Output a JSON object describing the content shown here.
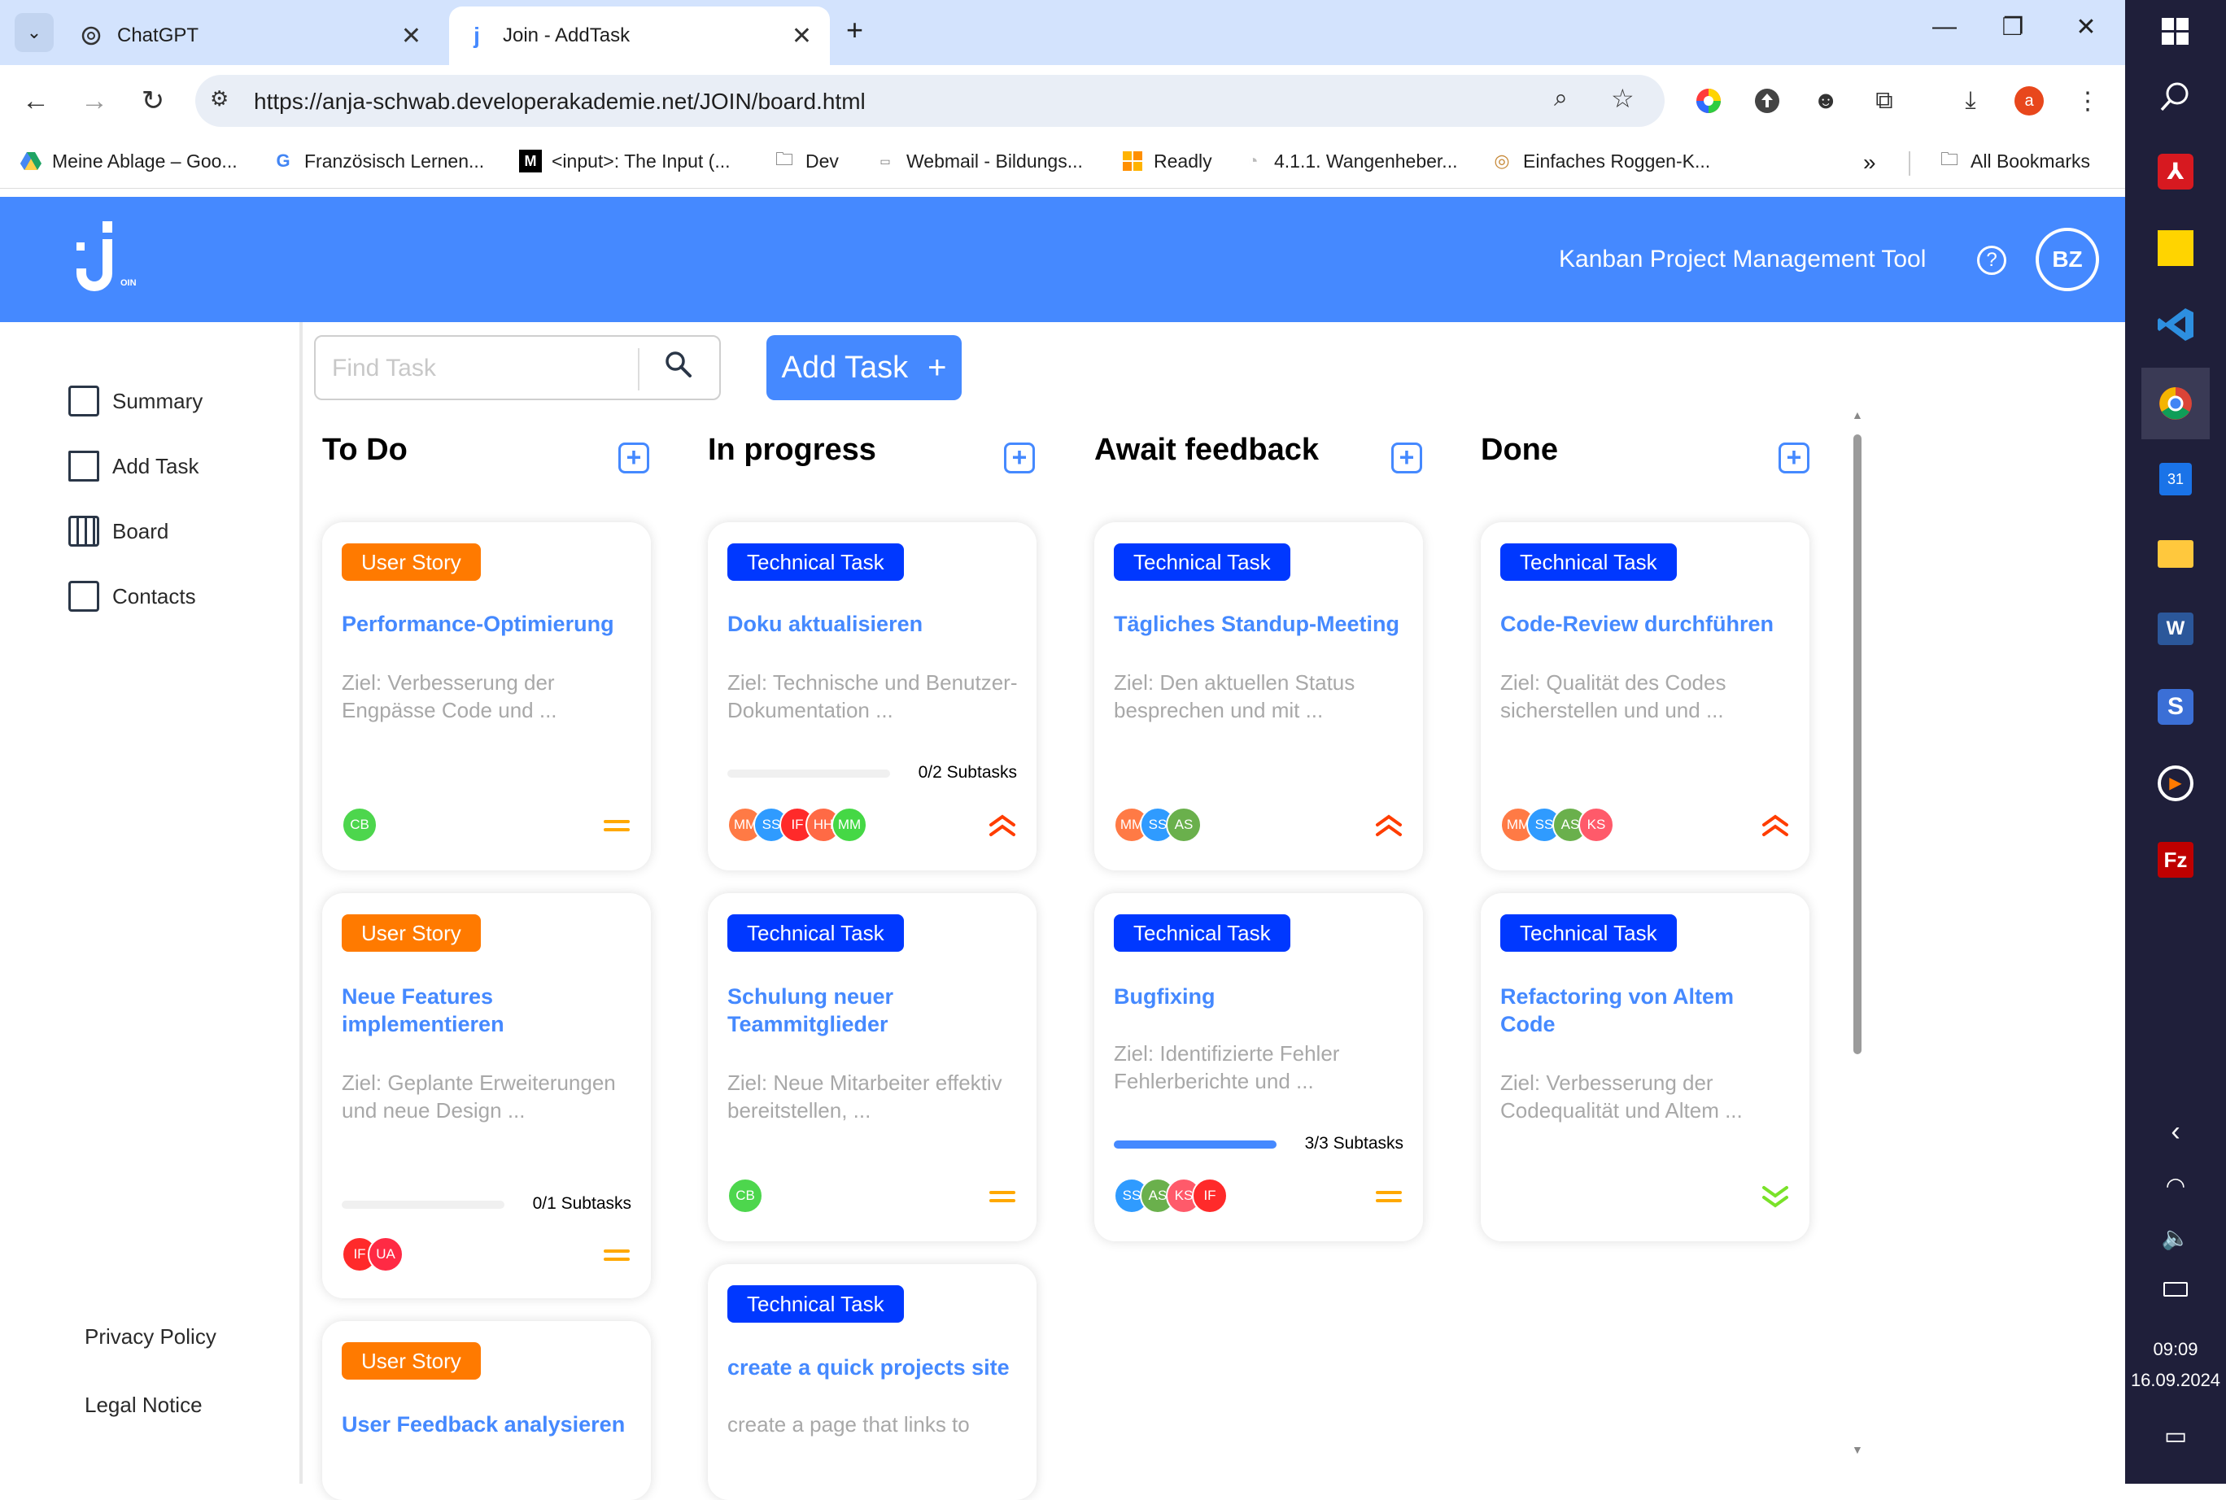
{
  "browser": {
    "tabs": [
      {
        "title": "ChatGPT"
      },
      {
        "title": "Join - AddTask"
      }
    ],
    "url": "https://anja-schwab.developerakademie.net/JOIN/board.html",
    "profile_initial": "a",
    "bookmarks": [
      {
        "label": "Meine Ablage – Goo...",
        "icon": "drive-icon"
      },
      {
        "label": "Französisch Lernen...",
        "icon": "google-icon"
      },
      {
        "label": "<input>: The Input (...",
        "icon": "mdn-icon"
      },
      {
        "label": "Dev",
        "icon": "folder-icon"
      },
      {
        "label": "Webmail - Bildungs...",
        "icon": "webmail-icon"
      },
      {
        "label": "Readly",
        "icon": "readly-icon"
      },
      {
        "label": "4.1.1. Wangenheber...",
        "icon": "page-icon"
      },
      {
        "label": "Einfaches Roggen-K...",
        "icon": "recipe-icon"
      },
      {
        "label": "All Bookmarks",
        "icon": "folder-icon"
      }
    ]
  },
  "app": {
    "header_title": "Kanban Project Management Tool",
    "user_initials": "BZ",
    "logo_sub": "OIN",
    "nav": [
      {
        "label": "Summary",
        "icon": "summary-icon"
      },
      {
        "label": "Add Task",
        "icon": "edit-icon"
      },
      {
        "label": "Board",
        "icon": "board-icon"
      },
      {
        "label": "Contacts",
        "icon": "contacts-icon"
      }
    ],
    "footer_links": [
      "Privacy Policy",
      "Legal Notice"
    ],
    "search_placeholder": "Find Task",
    "add_task_label": "Add Task"
  },
  "columns": [
    {
      "title": "To Do",
      "cards": [
        {
          "category": "User Story",
          "type": "story",
          "title": "Performance-Optimierung",
          "desc": "Ziel: Verbesserung der Engpässe Code und ...",
          "subtasks": null,
          "avatars": [
            {
              "i": "CB",
              "c": "#4dd64d"
            }
          ],
          "priority": "medium"
        },
        {
          "category": "User Story",
          "type": "story",
          "title": "Neue Features implementieren",
          "desc": "Ziel: Geplante Erweiterungen und neue Design ...",
          "subtasks": {
            "done": 0,
            "total": 1,
            "label": "0/1 Subtasks"
          },
          "avatars": [
            {
              "i": "IF",
              "c": "#ff2a2a"
            },
            {
              "i": "UA",
              "c": "#ff2a44"
            }
          ],
          "priority": "medium"
        },
        {
          "category": "User Story",
          "type": "story",
          "title": "User Feedback analysieren",
          "desc": "",
          "subtasks": null,
          "avatars": [],
          "priority": null
        }
      ]
    },
    {
      "title": "In progress",
      "cards": [
        {
          "category": "Technical Task",
          "type": "tech",
          "title": "Doku aktualisieren",
          "desc": "Ziel: Technische und Benutzer-Dokumentation ...",
          "subtasks": {
            "done": 0,
            "total": 2,
            "label": "0/2 Subtasks"
          },
          "avatars": [
            {
              "i": "MM",
              "c": "#ff7a45"
            },
            {
              "i": "SS",
              "c": "#2f9bff"
            },
            {
              "i": "IF",
              "c": "#ff2a2a"
            },
            {
              "i": "HH",
              "c": "#ff6a45"
            },
            {
              "i": "MM",
              "c": "#45d845"
            }
          ],
          "priority": "urgent"
        },
        {
          "category": "Technical Task",
          "type": "tech",
          "title": "Schulung neuer Teammitglieder",
          "desc": "Ziel: Neue Mitarbeiter effektiv bereitstellen, ...",
          "subtasks": null,
          "avatars": [
            {
              "i": "CB",
              "c": "#4dd64d"
            }
          ],
          "priority": "medium"
        },
        {
          "category": "Technical Task",
          "type": "tech",
          "title": "create a quick projects site",
          "desc": "create a page that links to",
          "subtasks": null,
          "avatars": [],
          "priority": null
        }
      ]
    },
    {
      "title": "Await feedback",
      "cards": [
        {
          "category": "Technical Task",
          "type": "tech",
          "title": "Tägliches Standup-Meeting",
          "desc": "Ziel: Den aktuellen Status besprechen und mit ...",
          "subtasks": null,
          "avatars": [
            {
              "i": "MM",
              "c": "#ff7a45"
            },
            {
              "i": "SS",
              "c": "#2f9bff"
            },
            {
              "i": "AS",
              "c": "#6ab04c"
            }
          ],
          "priority": "urgent"
        },
        {
          "category": "Technical Task",
          "type": "tech",
          "title": "Bugfixing",
          "desc": "Ziel: Identifizierte Fehler Fehlerberichte und ...",
          "subtasks": {
            "done": 3,
            "total": 3,
            "label": "3/3 Subtasks"
          },
          "avatars": [
            {
              "i": "SS",
              "c": "#2f9bff"
            },
            {
              "i": "AS",
              "c": "#6ab04c"
            },
            {
              "i": "KS",
              "c": "#ff5a6a"
            },
            {
              "i": "IF",
              "c": "#ff2a2a"
            }
          ],
          "priority": "medium"
        }
      ]
    },
    {
      "title": "Done",
      "cards": [
        {
          "category": "Technical Task",
          "type": "tech",
          "title": "Code-Review durchführen",
          "desc": "Ziel: Qualität des Codes sicherstellen und und ...",
          "subtasks": null,
          "avatars": [
            {
              "i": "MM",
              "c": "#ff7a45"
            },
            {
              "i": "SS",
              "c": "#2f9bff"
            },
            {
              "i": "AS",
              "c": "#6ab04c"
            },
            {
              "i": "KS",
              "c": "#ff5a6a"
            }
          ],
          "priority": "urgent"
        },
        {
          "category": "Technical Task",
          "type": "tech",
          "title": "Refactoring von Altem Code",
          "desc": "Ziel: Verbesserung der Codequalität und Altem ...",
          "subtasks": null,
          "avatars": [],
          "priority": "low"
        }
      ]
    }
  ],
  "taskbar": {
    "time": "09:09",
    "date": "16.09.2024"
  },
  "colors": {
    "accent": "#4589ff",
    "story": "#ff7a00",
    "tech": "#0038ff",
    "urgent": "#ff3d00",
    "medium": "#ffa800",
    "low": "#7ae229"
  }
}
